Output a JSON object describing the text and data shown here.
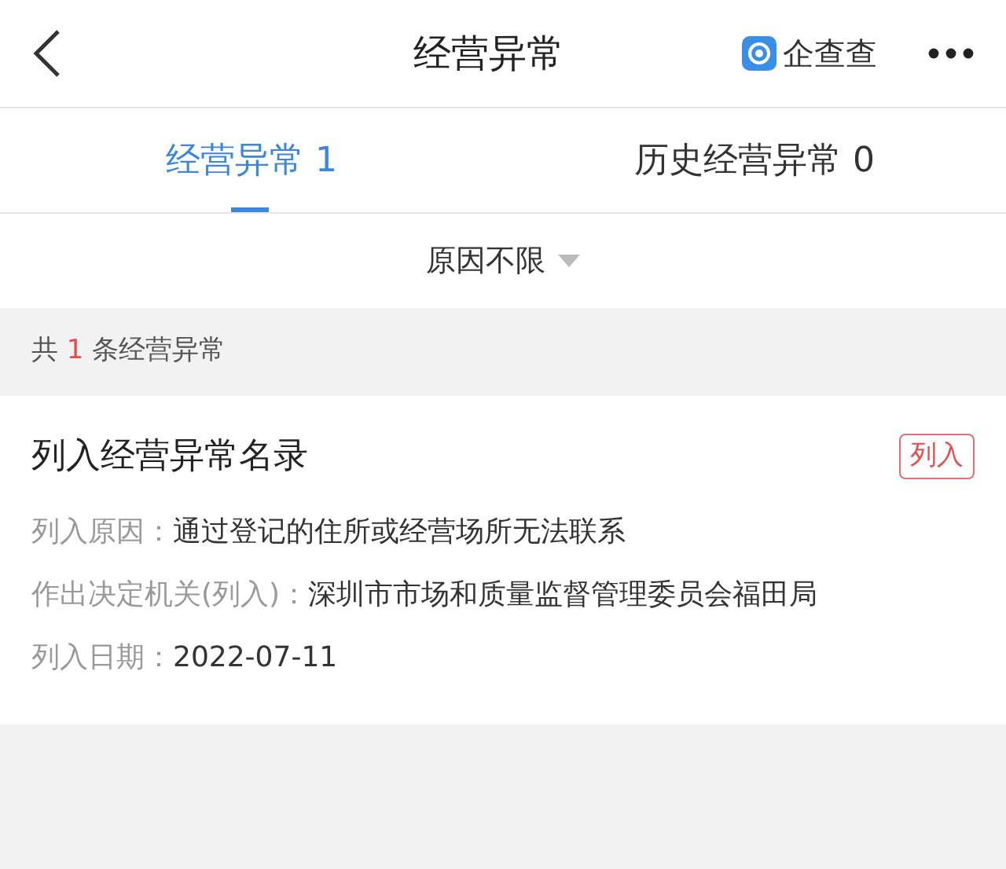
{
  "header": {
    "title": "经营异常",
    "brand": "企查查"
  },
  "tabs": [
    {
      "label": "经营异常 1",
      "selected": true
    },
    {
      "label": "历史经营异常 0",
      "selected": false
    }
  ],
  "filter": {
    "label": "原因不限"
  },
  "summary": {
    "prefix": "共",
    "count": "1",
    "suffix": "条经营异常"
  },
  "records": [
    {
      "title": "列入经营异常名录",
      "tag": "列入",
      "fields": [
        {
          "label": "列入原因：",
          "value": "通过登记的住所或经营场所无法联系"
        },
        {
          "label": "作出决定机关(列入)：",
          "value": "深圳市市场和质量监督管理委员会福田局"
        },
        {
          "label": "列入日期：",
          "value": "2022-07-11"
        }
      ]
    }
  ]
}
